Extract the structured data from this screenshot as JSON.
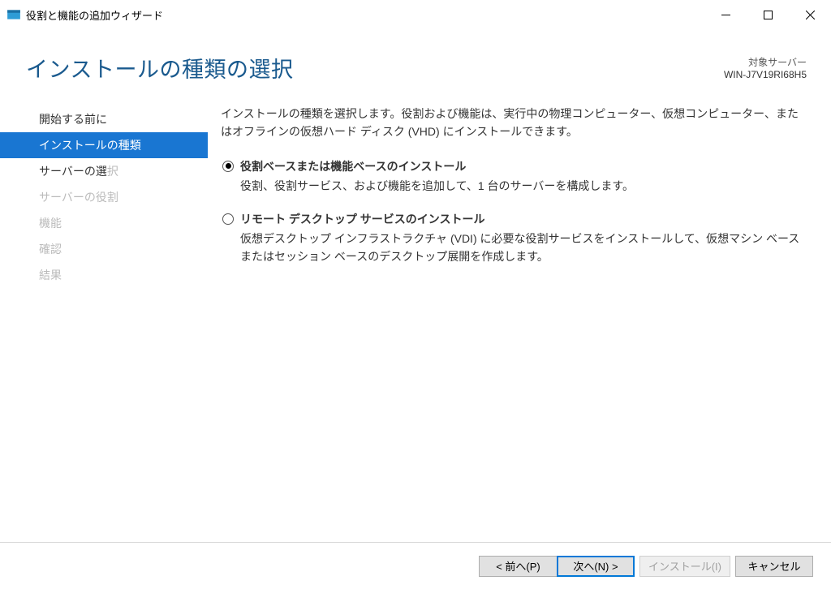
{
  "window": {
    "title": "役割と機能の追加ウィザード"
  },
  "header": {
    "page_title": "インストールの種類の選択",
    "target_label": "対象サーバー",
    "target_server": "WIN-J7V19RI68H5"
  },
  "sidebar": {
    "items": [
      {
        "label": "開始する前に",
        "state": "normal"
      },
      {
        "label": "インストールの種類",
        "state": "active"
      },
      {
        "label_main": "サーバーの選",
        "label_tail": "択",
        "state": "partial"
      },
      {
        "label": "サーバーの役割",
        "state": "disabled"
      },
      {
        "label": "機能",
        "state": "disabled"
      },
      {
        "label": "確認",
        "state": "disabled"
      },
      {
        "label": "結果",
        "state": "disabled"
      }
    ]
  },
  "main": {
    "intro": "インストールの種類を選択します。役割および機能は、実行中の物理コンピューター、仮想コンピューター、またはオフラインの仮想ハード ディスク (VHD) にインストールできます。",
    "options": [
      {
        "title": "役割ベースまたは機能ベースのインストール",
        "desc": "役割、役割サービス、および機能を追加して、1 台のサーバーを構成します。",
        "selected": true
      },
      {
        "title": "リモート デスクトップ サービスのインストール",
        "desc": "仮想デスクトップ インフラストラクチャ (VDI) に必要な役割サービスをインストールして、仮想マシン ベースまたはセッション ベースのデスクトップ展開を作成します。",
        "selected": false
      }
    ]
  },
  "footer": {
    "prev": "< 前へ(P)",
    "next": "次へ(N) >",
    "install": "インストール(I)",
    "cancel": "キャンセル"
  }
}
